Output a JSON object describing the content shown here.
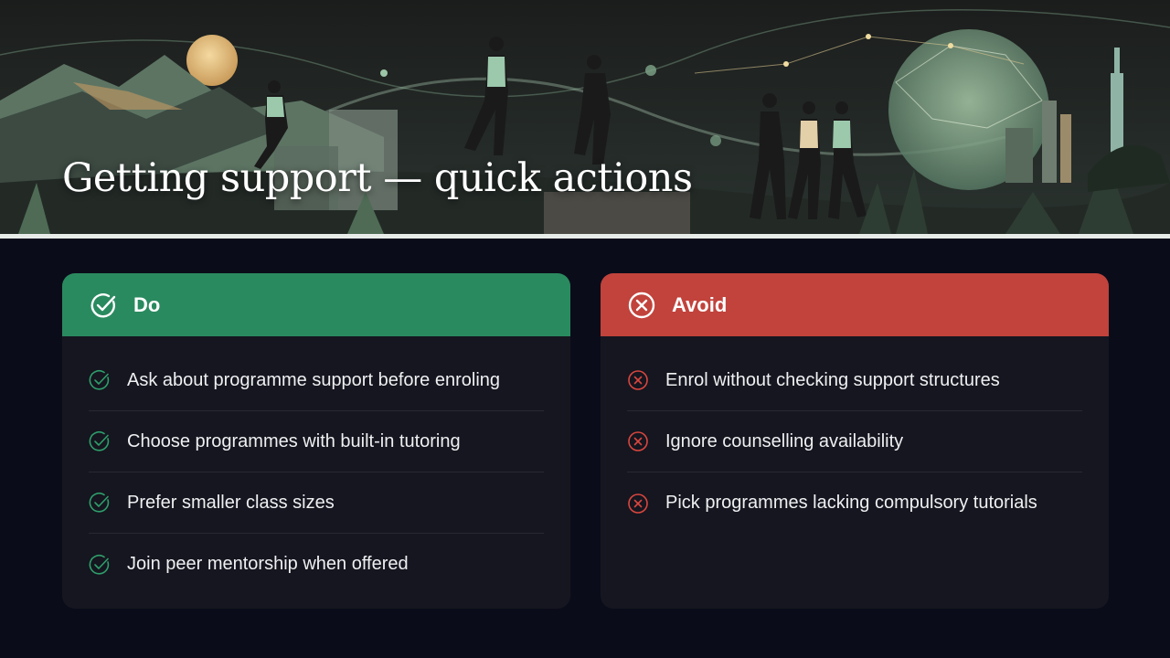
{
  "title": "Getting support — quick actions",
  "colors": {
    "background": "#0b0c1a",
    "card": "#15161f",
    "do_accent": "#2a8a5f",
    "avoid_accent": "#c1433c"
  },
  "do": {
    "label": "Do",
    "icon": "check-circle-icon",
    "items": [
      "Ask about programme support before enroling",
      "Choose programmes with built-in tutoring",
      "Prefer smaller class sizes",
      "Join peer mentorship when offered"
    ]
  },
  "avoid": {
    "label": "Avoid",
    "icon": "x-circle-icon",
    "items": [
      "Enrol without checking support structures",
      "Ignore counselling availability",
      "Pick programmes lacking compulsory tutorials"
    ]
  }
}
